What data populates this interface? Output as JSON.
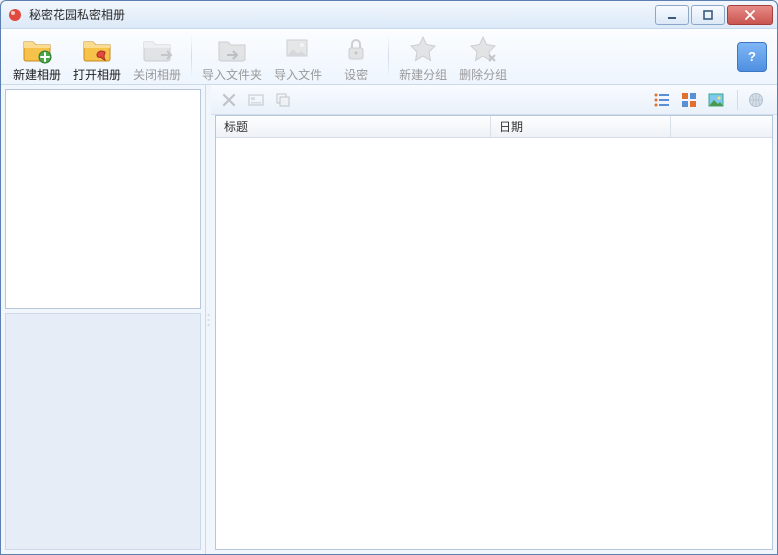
{
  "window": {
    "title": "秘密花园私密相册"
  },
  "toolbar": {
    "new_album": "新建相册",
    "open_album": "打开相册",
    "close_album": "关闭相册",
    "import_folder": "导入文件夹",
    "import_file": "导入文件",
    "settings": "设密",
    "new_group": "新建分组",
    "delete_group": "删除分组"
  },
  "columns": {
    "title": "标题",
    "date": "日期"
  }
}
